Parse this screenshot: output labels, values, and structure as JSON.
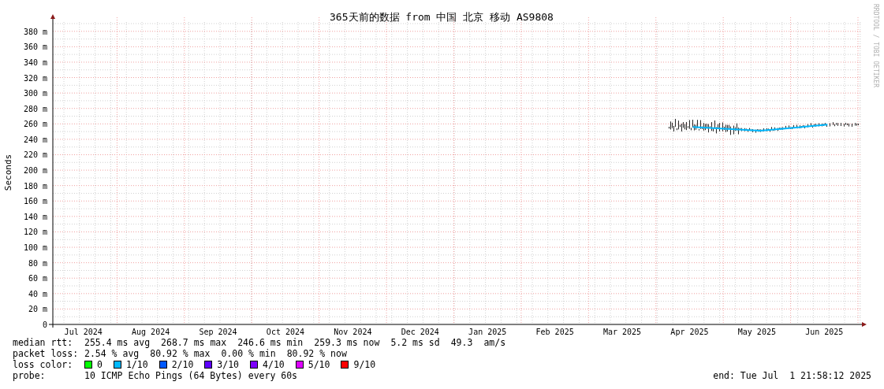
{
  "graph": {
    "side_text": "RRDTOOL / TOBI OETIKER",
    "chart_data": {
      "type": "line",
      "title": "365天前的数据 from 中国 北京 移动 AS9808",
      "ylabel": "Seconds",
      "grid": true,
      "ylim": [
        0,
        392
      ],
      "categories": [
        "Jul 2024",
        "Aug 2024",
        "Sep 2024",
        "Oct 2024",
        "Nov 2024",
        "Dec 2024",
        "Jan 2025",
        "Feb 2025",
        "Mar 2025",
        "Apr 2025",
        "May 2025",
        "Jun 2025"
      ],
      "yticks": [
        {
          "value": 0,
          "label": "0"
        },
        {
          "value": 20,
          "label": "20 m"
        },
        {
          "value": 40,
          "label": "40 m"
        },
        {
          "value": 60,
          "label": "60 m"
        },
        {
          "value": 80,
          "label": "80 m"
        },
        {
          "value": 100,
          "label": "100 m"
        },
        {
          "value": 120,
          "label": "120 m"
        },
        {
          "value": 140,
          "label": "140 m"
        },
        {
          "value": 160,
          "label": "160 m"
        },
        {
          "value": 180,
          "label": "180 m"
        },
        {
          "value": 200,
          "label": "200 m"
        },
        {
          "value": 220,
          "label": "220 m"
        },
        {
          "value": 240,
          "label": "240 m"
        },
        {
          "value": 260,
          "label": "260 m"
        },
        {
          "value": 280,
          "label": "280 m"
        },
        {
          "value": 300,
          "label": "300 m"
        },
        {
          "value": 320,
          "label": "320 m"
        },
        {
          "value": 340,
          "label": "340 m"
        },
        {
          "value": 360,
          "label": "360 m"
        },
        {
          "value": 380,
          "label": "380 m"
        }
      ],
      "series": [
        {
          "color": "#00b8ff",
          "values": [
            null,
            null,
            null,
            null,
            null,
            null,
            null,
            null,
            null,
            256,
            251,
            259
          ]
        }
      ]
    }
  },
  "legend": {
    "median_rtt": {
      "label": "median rtt:",
      "values": [
        "255.4 ms avg",
        "268.7 ms max",
        "246.6 ms min",
        "259.3 ms now",
        "5.2 ms sd",
        "49.3",
        "am/s"
      ]
    },
    "packet_loss": {
      "label": "packet loss:",
      "values": [
        "2.54 % avg",
        "80.92 % max",
        "0.00 % min",
        "80.92 % now"
      ]
    },
    "loss_color": {
      "label": "loss color:",
      "items": [
        {
          "label": "0",
          "color": "#00ff00"
        },
        {
          "label": "1/10",
          "color": "#00b8ff"
        },
        {
          "label": "2/10",
          "color": "#0059ff"
        },
        {
          "label": "3/10",
          "color": "#5e00ff"
        },
        {
          "label": "4/10",
          "color": "#7e00ff"
        },
        {
          "label": "5/10",
          "color": "#dd00ff"
        },
        {
          "label": "9/10",
          "color": "#ff0000"
        }
      ]
    },
    "probe": {
      "label": "probe:",
      "value": "10 ICMP Echo Pings (64 Bytes) every 60s"
    },
    "end": "end: Tue Jul  1 21:58:12 2025"
  }
}
